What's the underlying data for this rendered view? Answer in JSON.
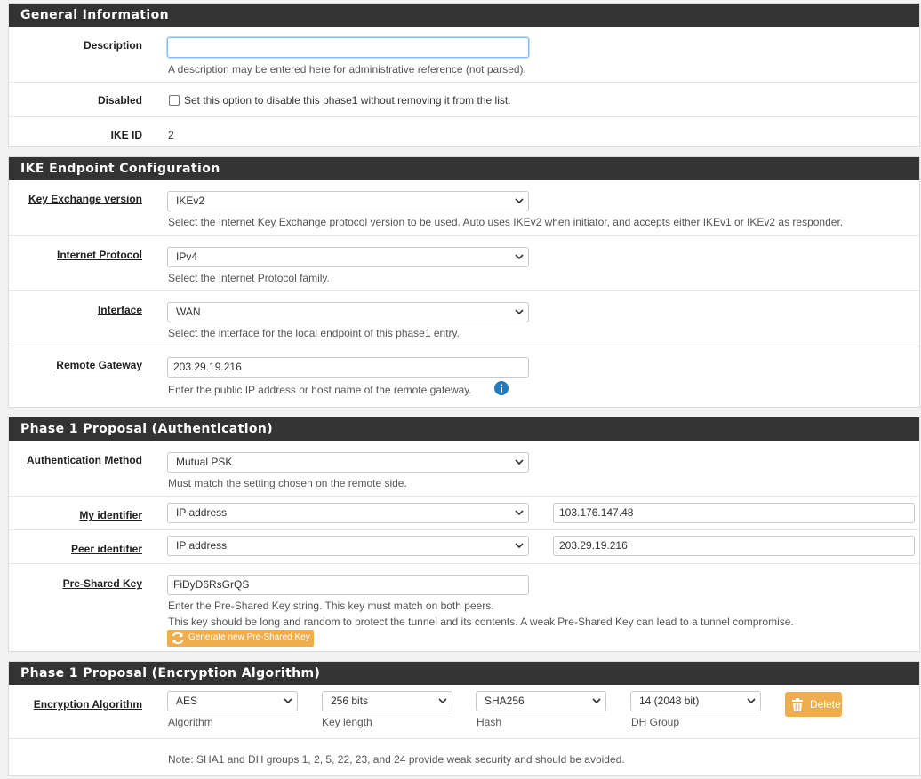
{
  "general": {
    "heading": "General Information",
    "description": {
      "label": "Description",
      "value": "",
      "help": "A description may be entered here for administrative reference (not parsed)."
    },
    "disabled": {
      "label": "Disabled",
      "text": "Set this option to disable this phase1 without removing it from the list."
    },
    "ike_id": {
      "label": "IKE ID",
      "value": "2"
    }
  },
  "endpoint": {
    "heading": "IKE Endpoint Configuration",
    "key_exchange": {
      "label": "Key Exchange version",
      "value": "IKEv2",
      "help": "Select the Internet Key Exchange protocol version to be used. Auto uses IKEv2 when initiator, and accepts either IKEv1 or IKEv2 as responder."
    },
    "protocol": {
      "label": "Internet Protocol",
      "value": "IPv4",
      "help": "Select the Internet Protocol family."
    },
    "interface": {
      "label": "Interface",
      "value": "WAN",
      "help": "Select the interface for the local endpoint of this phase1 entry."
    },
    "remote_gateway": {
      "label": "Remote Gateway",
      "value": "203.29.19.216",
      "help": "Enter the public IP address or host name of the remote gateway."
    }
  },
  "auth": {
    "heading": "Phase 1 Proposal (Authentication)",
    "method": {
      "label": "Authentication Method",
      "value": "Mutual PSK",
      "help": "Must match the setting chosen on the remote side."
    },
    "my_id": {
      "label": "My identifier",
      "type": "IP address",
      "value": "103.176.147.48"
    },
    "peer_id": {
      "label": "Peer identifier",
      "type": "IP address",
      "value": "203.29.19.216"
    },
    "psk": {
      "label": "Pre-Shared Key",
      "value": "FiDyD6RsGrQS",
      "help1": "Enter the Pre-Shared Key string. This key must match on both peers.",
      "help2": "This key should be long and random to protect the tunnel and its contents. A weak Pre-Shared Key can lead to a tunnel compromise.",
      "generate_label": "Generate new Pre-Shared Key"
    }
  },
  "encryption": {
    "heading": "Phase 1 Proposal (Encryption Algorithm)",
    "label": "Encryption Algorithm",
    "algorithm": {
      "value": "AES",
      "caption": "Algorithm"
    },
    "key_length": {
      "value": "256 bits",
      "caption": "Key length"
    },
    "hash": {
      "value": "SHA256",
      "caption": "Hash"
    },
    "dh_group": {
      "value": "14 (2048 bit)",
      "caption": "DH Group"
    },
    "delete_label": "Delete",
    "note": "Note: SHA1 and DH groups 1, 2, 5, 22, 23, and 24 provide weak security and should be avoided."
  },
  "colors": {
    "heading_bg": "#333333",
    "accent_orange": "#f0ad4e",
    "info_blue": "#1e7bc4"
  }
}
